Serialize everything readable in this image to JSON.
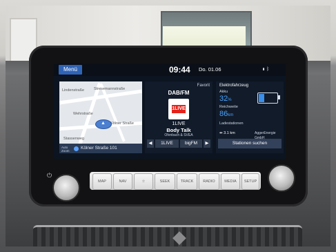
{
  "status": {
    "menu_label": "Menü",
    "time": "09:44",
    "date": "Do. 01.06"
  },
  "map": {
    "labels": [
      "Wehrstraße",
      "Stresemannstraße",
      "Kölner Straße",
      "Stassenweg",
      "Lindenstraße"
    ],
    "auto_zoom": "Auto Zoom",
    "street": "Kölner Straße 101"
  },
  "radio": {
    "favorite": "Favorit",
    "source": "DAB/FM",
    "logo_text": "1LIVE",
    "station": "1LIVE",
    "show": "Body Talk",
    "hosts": "Ofenbach & SVEA",
    "prev_icon": "◀",
    "station_button": "1LIVE",
    "band_button": "bigFM",
    "next_icon": "▶"
  },
  "ev": {
    "title": "Elektrofahrzeug",
    "battery_label": "Akku",
    "battery_value": "32",
    "battery_unit": "%",
    "battery_level": 0.32,
    "range_label": "Reichweite",
    "range_value": "86",
    "range_unit": "km",
    "stations_label": "Ladestationen",
    "station_distance": "3.1 km",
    "station_operator": "AggerEnergie GmbH",
    "search_button": "Stationen suchen"
  },
  "hard_keys": [
    "MAP",
    "NAV",
    "☆",
    "SEEK",
    "TRACK",
    "RADIO",
    "MEDIA",
    "SETUP"
  ],
  "colors": {
    "accent": "#2f63b6",
    "ev_value": "#4aa3ff",
    "panel_bg": "#111b2a"
  }
}
